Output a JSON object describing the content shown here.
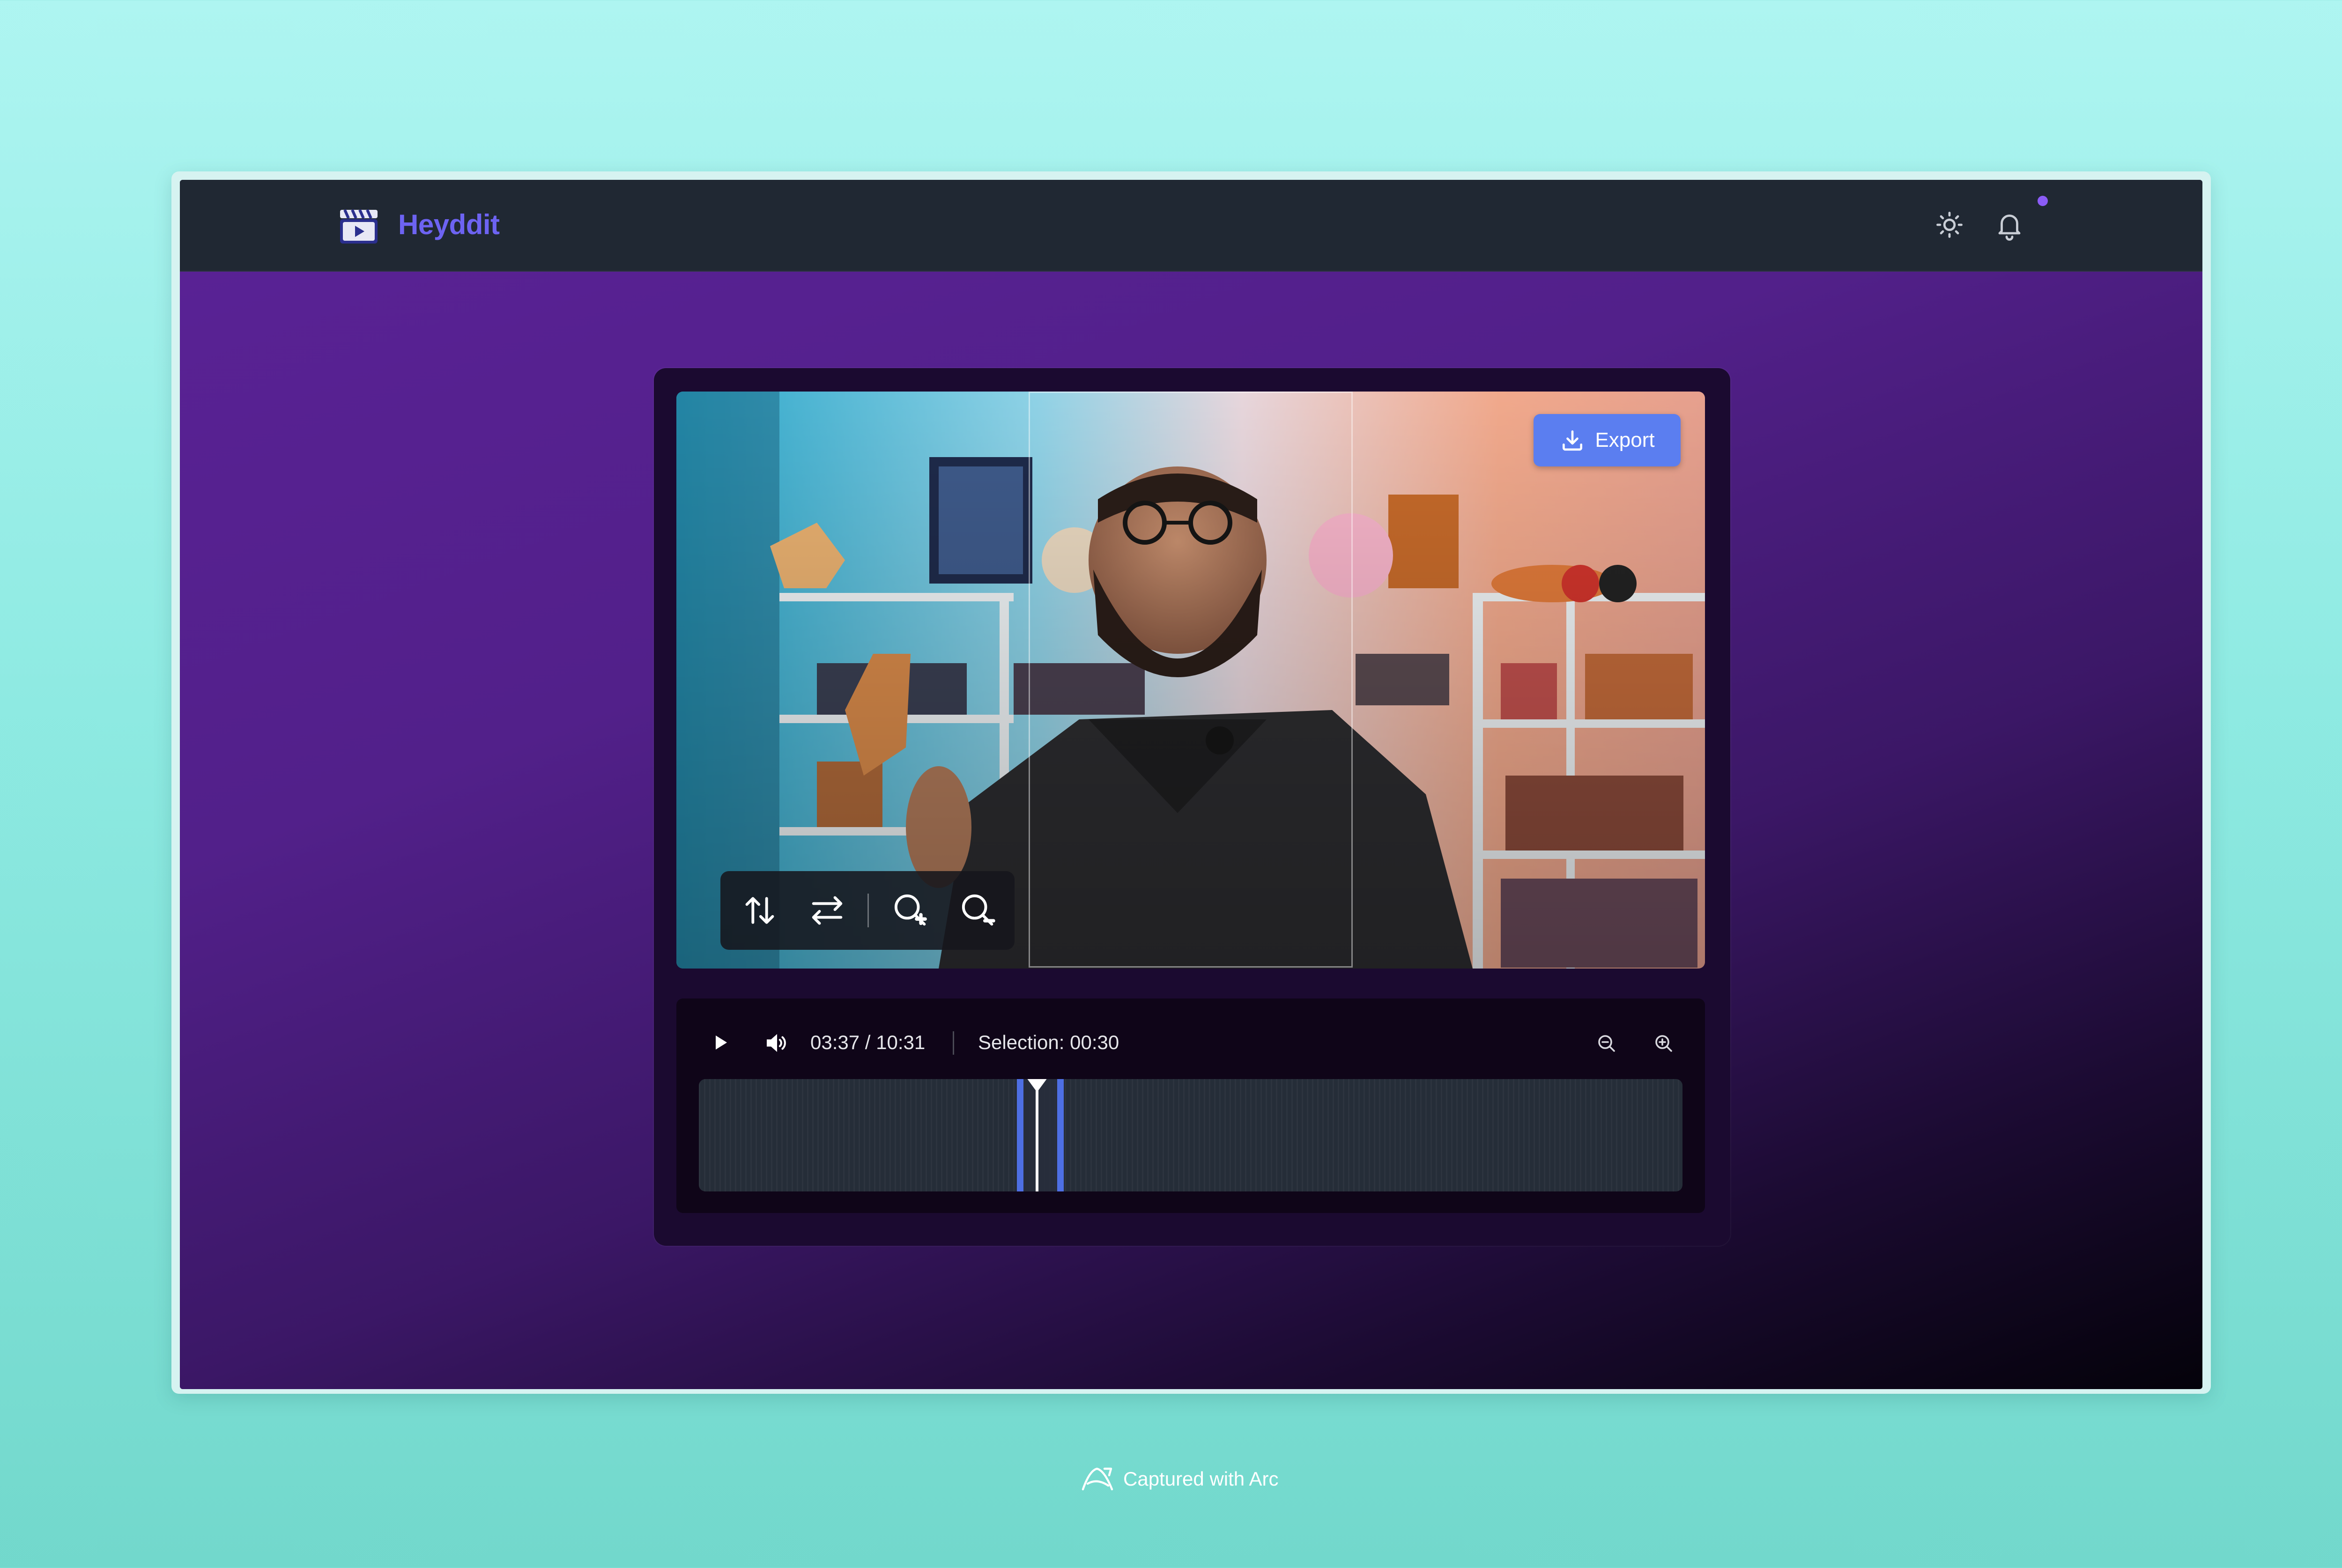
{
  "app": {
    "name": "Heyddit",
    "logo_icon": "clapperboard-play-icon",
    "theme_icon": "sun-icon",
    "notification_icon": "bell-icon",
    "has_unread_notifications": true
  },
  "editor": {
    "export_label": "Export",
    "export_icon": "download-icon",
    "crop_tools": [
      {
        "name": "flip-vertical",
        "icon": "arrows-up-down-icon"
      },
      {
        "name": "flip-horizontal",
        "icon": "arrows-left-right-icon"
      },
      {
        "name": "zoom-in",
        "icon": "zoom-in-icon"
      },
      {
        "name": "zoom-out",
        "icon": "zoom-out-icon"
      }
    ],
    "playback": {
      "current_time": "03:37",
      "total_time": "10:31",
      "time_display": "03:37 / 10:31",
      "selection_label": "Selection: 00:30"
    },
    "timeline": {
      "selection_start_fraction": 0.3235,
      "selection_end_fraction": 0.3713,
      "playhead_fraction": 0.3437
    }
  },
  "colors": {
    "brand": "#6d63f2",
    "accent": "#5b7ef0",
    "selection": "#4e6fe3",
    "notification_dot": "#8b5cf6"
  },
  "footer": {
    "text": "Captured with Arc"
  }
}
